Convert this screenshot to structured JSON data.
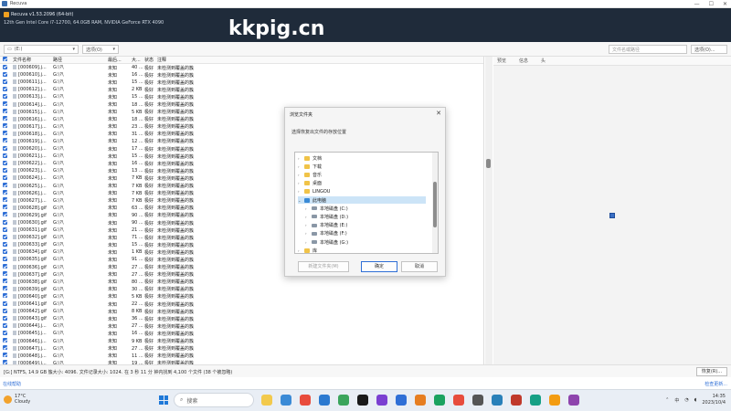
{
  "window": {
    "title": "Recuva",
    "controls": [
      "—",
      "☐",
      "✕"
    ]
  },
  "header": {
    "app_name": "Recuva v1.53.2096 (64-bit)",
    "system_info": "12th Gen Intel Core i7-12700, 64.0GB RAM, NVIDIA GeForce RTX 4090"
  },
  "watermark": "kkpig.cn",
  "toolbar": {
    "drive_select": "(E:)",
    "filter_select": "选项(O)",
    "search_placeholder": "文件名或路径",
    "options_button": "选项(O)..."
  },
  "filelist": {
    "columns": [
      "文件名称",
      "路径",
      "最后...",
      "大...",
      "状态",
      "注释"
    ],
    "rows": [
      {
        "name": "[000609].j...",
        "path": "G:\\?\\",
        "modified": "未知",
        "size": "40 ...",
        "state": "极好",
        "note": "未检测到覆盖的簇"
      },
      {
        "name": "[000610].j...",
        "path": "G:\\?\\",
        "modified": "未知",
        "size": "16 ...",
        "state": "极好",
        "note": "未检测到覆盖的簇"
      },
      {
        "name": "[000611].j...",
        "path": "G:\\?\\",
        "modified": "未知",
        "size": "15 ...",
        "state": "极好",
        "note": "未检测到覆盖的簇"
      },
      {
        "name": "[000612].j...",
        "path": "G:\\?\\",
        "modified": "未知",
        "size": "2 KB",
        "state": "极好",
        "note": "未检测到覆盖的簇"
      },
      {
        "name": "[000613].j...",
        "path": "G:\\?\\",
        "modified": "未知",
        "size": "15 ...",
        "state": "极好",
        "note": "未检测到覆盖的簇"
      },
      {
        "name": "[000614].j...",
        "path": "G:\\?\\",
        "modified": "未知",
        "size": "18 ...",
        "state": "极好",
        "note": "未检测到覆盖的簇"
      },
      {
        "name": "[000615].j...",
        "path": "G:\\?\\",
        "modified": "未知",
        "size": "5 KB",
        "state": "极好",
        "note": "未检测到覆盖的簇"
      },
      {
        "name": "[000616].j...",
        "path": "G:\\?\\",
        "modified": "未知",
        "size": "18 ...",
        "state": "极好",
        "note": "未检测到覆盖的簇"
      },
      {
        "name": "[000617].j...",
        "path": "G:\\?\\",
        "modified": "未知",
        "size": "23 ...",
        "state": "极好",
        "note": "未检测到覆盖的簇"
      },
      {
        "name": "[000618].j...",
        "path": "G:\\?\\",
        "modified": "未知",
        "size": "31 ...",
        "state": "极好",
        "note": "未检测到覆盖的簇"
      },
      {
        "name": "[000619].j...",
        "path": "G:\\?\\",
        "modified": "未知",
        "size": "12 ...",
        "state": "极好",
        "note": "未检测到覆盖的簇"
      },
      {
        "name": "[000620].j...",
        "path": "G:\\?\\",
        "modified": "未知",
        "size": "17 ...",
        "state": "极好",
        "note": "未检测到覆盖的簇"
      },
      {
        "name": "[000621].j...",
        "path": "G:\\?\\",
        "modified": "未知",
        "size": "15 ...",
        "state": "极好",
        "note": "未检测到覆盖的簇"
      },
      {
        "name": "[000622].j...",
        "path": "G:\\?\\",
        "modified": "未知",
        "size": "16 ...",
        "state": "极好",
        "note": "未检测到覆盖的簇"
      },
      {
        "name": "[000623].j...",
        "path": "G:\\?\\",
        "modified": "未知",
        "size": "13 ...",
        "state": "极好",
        "note": "未检测到覆盖的簇"
      },
      {
        "name": "[000624].j...",
        "path": "G:\\?\\",
        "modified": "未知",
        "size": "7 KB",
        "state": "极好",
        "note": "未检测到覆盖的簇"
      },
      {
        "name": "[000625].j...",
        "path": "G:\\?\\",
        "modified": "未知",
        "size": "7 KB",
        "state": "极好",
        "note": "未检测到覆盖的簇"
      },
      {
        "name": "[000626].j...",
        "path": "G:\\?\\",
        "modified": "未知",
        "size": "7 KB",
        "state": "极好",
        "note": "未检测到覆盖的簇"
      },
      {
        "name": "[000627].j...",
        "path": "G:\\?\\",
        "modified": "未知",
        "size": "7 KB",
        "state": "极好",
        "note": "未检测到覆盖的簇"
      },
      {
        "name": "[000628].gif",
        "path": "G:\\?\\",
        "modified": "未知",
        "size": "63 ...",
        "state": "极好",
        "note": "未检测到覆盖的簇"
      },
      {
        "name": "[000629].gif",
        "path": "G:\\?\\",
        "modified": "未知",
        "size": "90 ...",
        "state": "极好",
        "note": "未检测到覆盖的簇"
      },
      {
        "name": "[000630].gif",
        "path": "G:\\?\\",
        "modified": "未知",
        "size": "90 ...",
        "state": "极好",
        "note": "未检测到覆盖的簇"
      },
      {
        "name": "[000631].gif",
        "path": "G:\\?\\",
        "modified": "未知",
        "size": "21 ...",
        "state": "极好",
        "note": "未检测到覆盖的簇"
      },
      {
        "name": "[000632].gif",
        "path": "G:\\?\\",
        "modified": "未知",
        "size": "71 ...",
        "state": "极好",
        "note": "未检测到覆盖的簇"
      },
      {
        "name": "[000633].gif",
        "path": "G:\\?\\",
        "modified": "未知",
        "size": "15 ...",
        "state": "极好",
        "note": "未检测到覆盖的簇"
      },
      {
        "name": "[000634].gif",
        "path": "G:\\?\\",
        "modified": "未知",
        "size": "1 KB",
        "state": "极好",
        "note": "未检测到覆盖的簇"
      },
      {
        "name": "[000635].gif",
        "path": "G:\\?\\",
        "modified": "未知",
        "size": "91 ...",
        "state": "极好",
        "note": "未检测到覆盖的簇"
      },
      {
        "name": "[000636].gif",
        "path": "G:\\?\\",
        "modified": "未知",
        "size": "27 ...",
        "state": "极好",
        "note": "未检测到覆盖的簇"
      },
      {
        "name": "[000637].gif",
        "path": "G:\\?\\",
        "modified": "未知",
        "size": "27 ...",
        "state": "极好",
        "note": "未检测到覆盖的簇"
      },
      {
        "name": "[000638].gif",
        "path": "G:\\?\\",
        "modified": "未知",
        "size": "80 ...",
        "state": "极好",
        "note": "未检测到覆盖的簇"
      },
      {
        "name": "[000639].gif",
        "path": "G:\\?\\",
        "modified": "未知",
        "size": "30 ...",
        "state": "极好",
        "note": "未检测到覆盖的簇"
      },
      {
        "name": "[000640].gif",
        "path": "G:\\?\\",
        "modified": "未知",
        "size": "5 KB",
        "state": "极好",
        "note": "未检测到覆盖的簇"
      },
      {
        "name": "[000641].gif",
        "path": "G:\\?\\",
        "modified": "未知",
        "size": "22 ...",
        "state": "极好",
        "note": "未检测到覆盖的簇"
      },
      {
        "name": "[000642].gif",
        "path": "G:\\?\\",
        "modified": "未知",
        "size": "8 KB",
        "state": "极好",
        "note": "未检测到覆盖的簇"
      },
      {
        "name": "[000643].gif",
        "path": "G:\\?\\",
        "modified": "未知",
        "size": "36 ...",
        "state": "极好",
        "note": "未检测到覆盖的簇"
      },
      {
        "name": "[000644].j...",
        "path": "G:\\?\\",
        "modified": "未知",
        "size": "27 ...",
        "state": "极好",
        "note": "未检测到覆盖的簇"
      },
      {
        "name": "[000645].j...",
        "path": "G:\\?\\",
        "modified": "未知",
        "size": "16 ...",
        "state": "极好",
        "note": "未检测到覆盖的簇"
      },
      {
        "name": "[000646].j...",
        "path": "G:\\?\\",
        "modified": "未知",
        "size": "9 KB",
        "state": "极好",
        "note": "未检测到覆盖的簇"
      },
      {
        "name": "[000647].j...",
        "path": "G:\\?\\",
        "modified": "未知",
        "size": "27 ...",
        "state": "极好",
        "note": "未检测到覆盖的簇"
      },
      {
        "name": "[000648].j...",
        "path": "G:\\?\\",
        "modified": "未知",
        "size": "11 ...",
        "state": "极好",
        "note": "未检测到覆盖的簇"
      },
      {
        "name": "[000649].j...",
        "path": "G:\\?\\",
        "modified": "未知",
        "size": "19 ...",
        "state": "极好",
        "note": "未检测到覆盖的簇"
      }
    ]
  },
  "rightpanel": {
    "tabs": [
      "预览",
      "信息",
      "头"
    ]
  },
  "statusbar": {
    "text": "[G:] NTFS, 14.9 GB 簇大小: 4096. 文件记录大小: 1024. 在 3 秒 11 分 钟内找到 4,100 个文件 (38 个被忽略)",
    "recover_button": "恢复(R)..."
  },
  "footer": {
    "left_link": "在线帮助",
    "right_link": "检查更新..."
  },
  "dialog": {
    "title": "浏览文件夹",
    "close": "✕",
    "prompt": "选择恢复出文件的存放位置",
    "tree": [
      {
        "label": "文档",
        "icon": "folder",
        "indent": 0,
        "caret": "›"
      },
      {
        "label": "下载",
        "icon": "folder",
        "indent": 0,
        "caret": "›"
      },
      {
        "label": "音乐",
        "icon": "folder",
        "indent": 0,
        "caret": "›"
      },
      {
        "label": "桌面",
        "icon": "folder",
        "indent": 0,
        "caret": "›"
      },
      {
        "label": "LINGOU",
        "icon": "folder",
        "indent": 0,
        "caret": "›"
      },
      {
        "label": "此电脑",
        "icon": "pc",
        "indent": 0,
        "caret": "⌄",
        "selected": true
      },
      {
        "label": "本地磁盘 (C:)",
        "icon": "drive",
        "indent": 1,
        "caret": "›"
      },
      {
        "label": "本地磁盘 (D:)",
        "icon": "drive",
        "indent": 1,
        "caret": "›"
      },
      {
        "label": "本地磁盘 (E:)",
        "icon": "drive",
        "indent": 1,
        "caret": "›"
      },
      {
        "label": "本地磁盘 (F:)",
        "icon": "drive",
        "indent": 1,
        "caret": "›"
      },
      {
        "label": "本地磁盘 (G:)",
        "icon": "drive",
        "indent": 1,
        "caret": "›"
      },
      {
        "label": "库",
        "icon": "folder",
        "indent": 0,
        "caret": "›"
      }
    ],
    "new_folder_button": "新建文件夹(M)",
    "ok_button": "确定",
    "cancel_button": "取消"
  },
  "taskbar": {
    "weather_temp": "17°C",
    "weather_desc": "Cloudy",
    "search_placeholder": "搜索",
    "tray_lang": "中",
    "time": "14:35",
    "date": "2023/10/4",
    "apps": [
      "#f2c94c",
      "#3a8ad6",
      "#e84b3c",
      "#2b79d0",
      "#3ba55c",
      "#1a1a1a",
      "#7a3fd1",
      "#2f6fd6",
      "#e67e22",
      "#1aa260",
      "#e74c3c",
      "#555555",
      "#2980b9",
      "#c0392b",
      "#16a085",
      "#f39c12",
      "#8e44ad"
    ]
  },
  "colors": {
    "header_bg": "#1f2b3a",
    "accent": "#2f6fd6"
  }
}
